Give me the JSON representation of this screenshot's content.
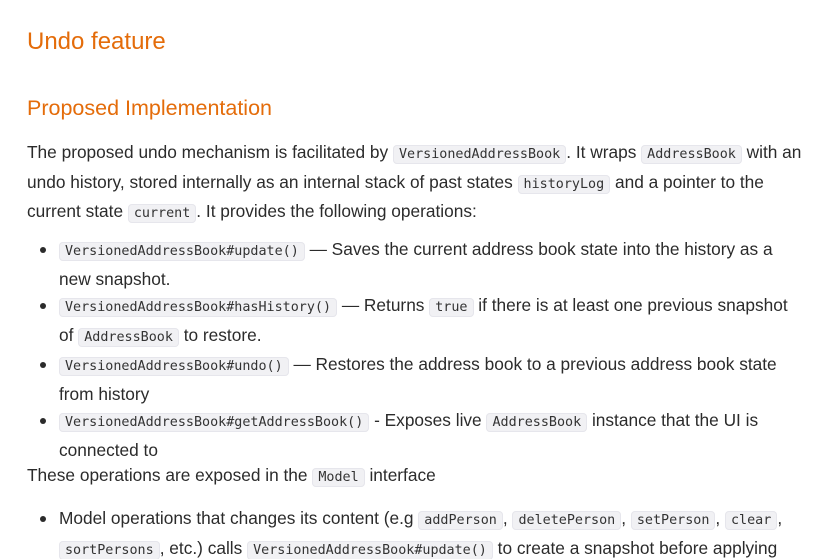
{
  "headings": {
    "h1": "Undo feature",
    "h2": "Proposed Implementation"
  },
  "intro": {
    "t1": "The proposed undo mechanism is facilitated by ",
    "c1": "VersionedAddressBook",
    "t2": ". It wraps ",
    "c2": "AddressBook",
    "t3": " with an undo history, stored internally as an internal stack of past states ",
    "c3": "historyLog",
    "t4": " and a pointer to the current state ",
    "c4": "current",
    "t5": ". It provides the following operations:"
  },
  "operations": [
    {
      "code": "VersionedAddressBook#update()",
      "text": " — Saves the current address book state into the history as a new snapshot."
    },
    {
      "code": "VersionedAddressBook#hasHistory()",
      "t1": " — Returns ",
      "code2": "true",
      "t2": " if there is at least one previous snapshot of ",
      "code3": "AddressBook",
      "t3": " to restore."
    },
    {
      "code": "VersionedAddressBook#undo()",
      "text": " — Restores the address book to a previous address book state from history"
    },
    {
      "code": "VersionedAddressBook#getAddressBook()",
      "t1": " - Exposes live ",
      "code2": "AddressBook",
      "t2": " instance that the UI is connected to"
    }
  ],
  "exposed": {
    "t1": "These operations are exposed in the ",
    "c1": "Model",
    "t2": " interface"
  },
  "model_ops": {
    "t1": "Model operations that changes its content (e.g ",
    "c1": "addPerson",
    "s1": ", ",
    "c2": "deletePerson",
    "s2": ", ",
    "c3": "setPerson",
    "s3": ", ",
    "c4": "clear",
    "s4": ", ",
    "c5": "sortPersons",
    "t2": ", etc.) calls ",
    "c6": "VersionedAddressBook#update()",
    "t3": " to create a snapshot before applying"
  }
}
